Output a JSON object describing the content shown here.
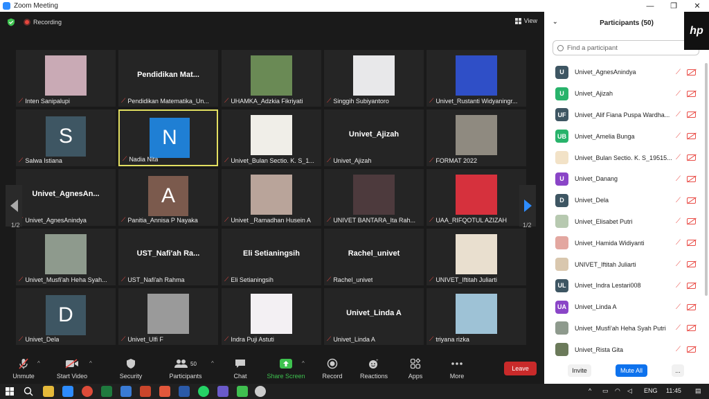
{
  "window": {
    "title": "Zoom Meeting",
    "minimize": "—",
    "restore": "❐",
    "close": "✕"
  },
  "topbar": {
    "recording": "Recording",
    "view": "View"
  },
  "tiles": [
    {
      "name": "Inten Sanipalupi",
      "big": "",
      "letter": "",
      "pic": "#c9aab5"
    },
    {
      "name": "Pendidikan Matematika_Un...",
      "big": "Pendidikan  Mat...",
      "letter": "",
      "pic": ""
    },
    {
      "name": "UHAMKA_Adzkia Fikriyati",
      "big": "",
      "letter": "",
      "pic": "#6a8a55"
    },
    {
      "name": "Singgih Subiyantoro",
      "big": "",
      "letter": "",
      "pic": "#e8e8ea"
    },
    {
      "name": "Univet_Rustanti Widyaningr...",
      "big": "",
      "letter": "",
      "pic": "#2f4fc7"
    },
    {
      "name": "Salwa Istiana",
      "big": "",
      "letter": "S",
      "pic": "#3e5663"
    },
    {
      "name": "Nadia Nita",
      "big": "",
      "letter": "N",
      "pic": "#1f7fd4"
    },
    {
      "name": "Univet_Bulan Sectio. K. S_1...",
      "big": "",
      "letter": "",
      "pic": "#f0eee8"
    },
    {
      "name": "Univet_Ajizah",
      "big": "Univet_Ajizah",
      "letter": "",
      "pic": ""
    },
    {
      "name": "FORMAT 2022",
      "big": "",
      "letter": "",
      "pic": "#8f8a80"
    },
    {
      "name": "Univet_AgnesAnindya",
      "big": "Univet_AgnesAn...",
      "letter": "",
      "pic": ""
    },
    {
      "name": "Panitia_Annisa P Nayaka",
      "big": "",
      "letter": "A",
      "pic": "#7b5a4d"
    },
    {
      "name": "Univet _Ramadhan Husein A",
      "big": "",
      "letter": "",
      "pic": "#b9a49a"
    },
    {
      "name": "UNIVET BANTARA_Ita Rah...",
      "big": "",
      "letter": "",
      "pic": "#4d3a3d"
    },
    {
      "name": "UAA_RIFQOTUL AZIZAH",
      "big": "",
      "letter": "",
      "pic": "#d6313d"
    },
    {
      "name": "Univet_Musfi'ah Heha Syah...",
      "big": "",
      "letter": "",
      "pic": "#8e9a8d"
    },
    {
      "name": "UST_Nafi'ah Rahma",
      "big": "UST_Nafi'ah  Ra...",
      "letter": "",
      "pic": ""
    },
    {
      "name": "Eli Setianingsih",
      "big": "Eli Setianingsih",
      "letter": "",
      "pic": ""
    },
    {
      "name": "Rachel_univet",
      "big": "Rachel_univet",
      "letter": "",
      "pic": ""
    },
    {
      "name": "UNIVET_Iftitah Juliarti",
      "big": "",
      "letter": "",
      "pic": "#e9dfcf"
    },
    {
      "name": "Univet_Dela",
      "big": "",
      "letter": "D",
      "pic": "#3e5663"
    },
    {
      "name": "Univet_Ulfi F",
      "big": "",
      "letter": "",
      "pic": "#9a9a9a"
    },
    {
      "name": "Indra Puji Astuti",
      "big": "",
      "letter": "",
      "pic": "#f3f0f3"
    },
    {
      "name": "Univet_Linda A",
      "big": "Univet_Linda A",
      "letter": "",
      "pic": ""
    },
    {
      "name": "triyana rizka",
      "big": "",
      "letter": "",
      "pic": "#9ec2d6"
    }
  ],
  "pagination": {
    "left": "1/2",
    "right": "1/2"
  },
  "toolbar": {
    "unmute": "Unmute",
    "start_video": "Start Video",
    "security": "Security",
    "participants": "Participants",
    "participants_count": "50",
    "chat": "Chat",
    "share_screen": "Share Screen",
    "record": "Record",
    "reactions": "Reactions",
    "apps": "Apps",
    "more": "More",
    "leave": "Leave"
  },
  "panel": {
    "title": "Participants (50)",
    "search_placeholder": "Find a participant",
    "invite": "Invite",
    "mute_all": "Mute All",
    "more": "...",
    "participants": [
      {
        "name": "Univet_AgnesAnindya",
        "initials": "U",
        "color": "#3e5663"
      },
      {
        "name": "Univet_Ajizah",
        "initials": "U",
        "color": "#28b36b"
      },
      {
        "name": "Univet_Alif Fiana Puspa Wardha...",
        "initials": "UF",
        "color": "#3e5663"
      },
      {
        "name": "Univet_Amelia Bunga",
        "initials": "UB",
        "color": "#28b36b"
      },
      {
        "name": "Univet_Bulan Sectio. K. S_19515...",
        "initials": "",
        "color": "#f2e2c7"
      },
      {
        "name": "Univet_Danang",
        "initials": "U",
        "color": "#8a45c7"
      },
      {
        "name": "Univet_Dela",
        "initials": "D",
        "color": "#3e5663"
      },
      {
        "name": "Univet_Elisabet Putri",
        "initials": "",
        "color": "#b7c9b0"
      },
      {
        "name": "Univet_Hamida Widiyanti",
        "initials": "",
        "color": "#e3a7a0"
      },
      {
        "name": "UNIVET_Iftitah Juliarti",
        "initials": "",
        "color": "#d9c7ae"
      },
      {
        "name": "Univet_Indra Lestari008",
        "initials": "UL",
        "color": "#3e5663"
      },
      {
        "name": "Univet_Linda A",
        "initials": "UA",
        "color": "#8a45c7"
      },
      {
        "name": "Univet_Musfi'ah Heha Syah Putri",
        "initials": "",
        "color": "#8e9a8d"
      },
      {
        "name": "Univet_Rista Gita",
        "initials": "",
        "color": "#6b7a5a"
      }
    ]
  },
  "hp_logo": "hp",
  "taskbar": {
    "lang": "ENG",
    "time": "11:45"
  },
  "colors": {
    "accent": "#2d8cff",
    "leave": "#c92a2a",
    "share": "#3ec24f",
    "muted": "#e94b45"
  }
}
